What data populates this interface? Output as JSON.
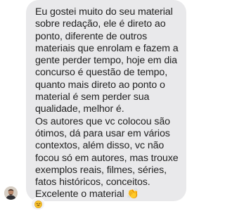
{
  "message": {
    "text": "Eu gostei muito do seu material\nsobre redação, ele é direto ao\nponto, diferente de outros\nmateriais que enrolam e fazem a\ngente perder tempo, hoje em dia\nconcurso é questão de tempo,\nquanto mais direto ao ponto o\nmaterial é sem perder sua\nqualidade, melhor é.\nOs autores que vc colocou são\nótimos, dá para usar em vários\ncontextos, além disso, vc não\nfocou só em autores, mas trouxe\nexemplos reais, filmes, séries,\nfatos históricos, conceitos.\nExcelente o material 👏"
  },
  "sender": {
    "avatar_icon": "user-avatar-icon"
  },
  "reaction": {
    "icon": "smiling-face-emoji"
  },
  "colors": {
    "bubble_background": "#e9e9eb",
    "text": "#222222",
    "page_background": "#ffffff"
  }
}
